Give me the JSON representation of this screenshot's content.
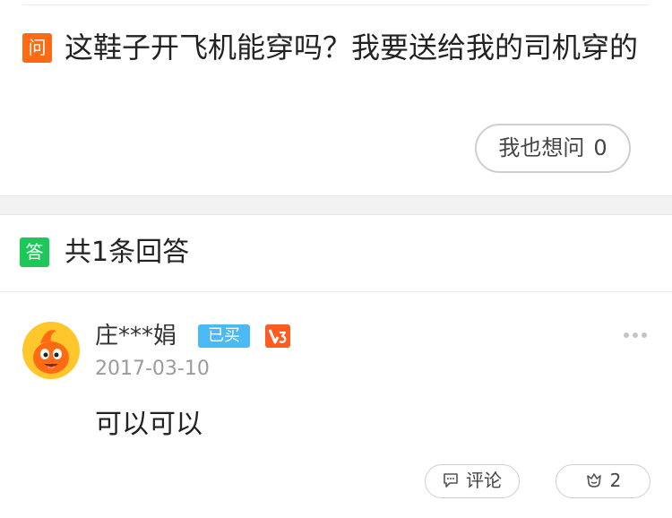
{
  "question": {
    "badge": "问",
    "text": "这鞋子开飞机能穿吗？我要送给我的司机穿的",
    "ask_too_label": "我也想问",
    "ask_too_count": "0"
  },
  "answers": {
    "badge": "答",
    "title": "共1条回答",
    "items": [
      {
        "username": "庄***娟",
        "bought_label": "已买",
        "level_icon": "level-v3-icon",
        "date": "2017-03-10",
        "text": "可以可以",
        "comment_label": "评论",
        "like_count": "2"
      }
    ]
  },
  "colors": {
    "question_badge": "#ff6a14",
    "answer_badge": "#1ec75a",
    "bought_badge": "#4ab9f4",
    "level_badge": "#ff5a1f",
    "avatar_bg": "#ffc72c",
    "avatar_mascot": "#ff6a14"
  }
}
